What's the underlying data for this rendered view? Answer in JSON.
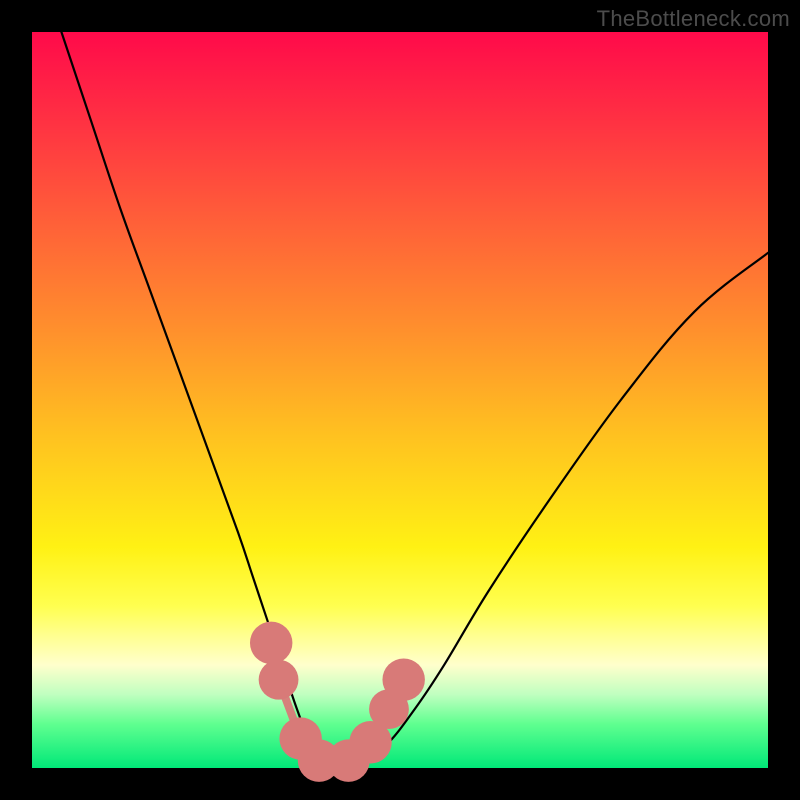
{
  "attribution": "TheBottleneck.com",
  "chart_data": {
    "type": "line",
    "title": "",
    "xlabel": "",
    "ylabel": "",
    "xlim": [
      0,
      100
    ],
    "ylim": [
      0,
      100
    ],
    "series": [
      {
        "name": "bottleneck-curve",
        "x": [
          4,
          8,
          12,
          16,
          20,
          24,
          28,
          30,
          32,
          34,
          36,
          38,
          40,
          42,
          44,
          48,
          52,
          56,
          62,
          70,
          80,
          90,
          100
        ],
        "y": [
          100,
          88,
          76,
          65,
          54,
          43,
          32,
          26,
          20,
          14,
          8,
          3,
          0.5,
          0.5,
          0.5,
          3,
          8,
          14,
          24,
          36,
          50,
          62,
          70
        ]
      }
    ],
    "markers": [
      {
        "name": "marker-left",
        "x": 32.5,
        "y": 17,
        "r": 2.6,
        "color": "#d87a78"
      },
      {
        "name": "marker-left-lower",
        "x": 33.5,
        "y": 12,
        "r": 2.4,
        "color": "#d87a78"
      },
      {
        "name": "marker-left-bottom",
        "x": 36.5,
        "y": 4,
        "r": 2.6,
        "color": "#d87a78"
      },
      {
        "name": "marker-bottom-1",
        "x": 39,
        "y": 1,
        "r": 2.6,
        "color": "#d87a78"
      },
      {
        "name": "marker-bottom-2",
        "x": 43,
        "y": 1,
        "r": 2.6,
        "color": "#d87a78"
      },
      {
        "name": "marker-right-bottom",
        "x": 46,
        "y": 3.5,
        "r": 2.6,
        "color": "#d87a78"
      },
      {
        "name": "marker-right-lower",
        "x": 48.5,
        "y": 8,
        "r": 2.4,
        "color": "#d87a78"
      },
      {
        "name": "marker-right",
        "x": 50.5,
        "y": 12,
        "r": 2.6,
        "color": "#d87a78"
      }
    ],
    "connector": {
      "color": "#d87a78",
      "width": 8,
      "points_x": [
        32.5,
        33.5,
        36.5,
        39,
        43,
        46,
        48.5,
        50.5
      ],
      "points_y": [
        17,
        12,
        4,
        1,
        1,
        3.5,
        8,
        12
      ]
    },
    "colors": {
      "curve_stroke": "#000000",
      "marker_fill": "#d87a78",
      "gradient_top": "#ff0a4a",
      "gradient_bottom": "#00e878"
    }
  }
}
